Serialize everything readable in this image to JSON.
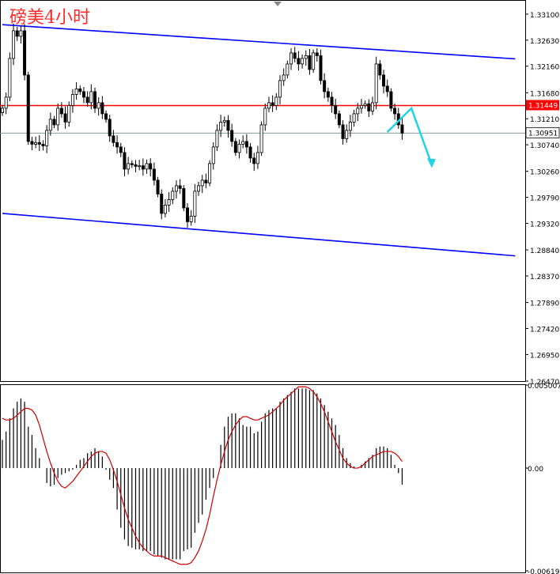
{
  "chart_data": [
    {
      "type": "candlestick",
      "title": "磅美4小时",
      "price_axis_ticks": [
        "1.33100",
        "1.32630",
        "1.32160",
        "1.31680",
        "1.31210",
        "1.30740",
        "1.30260",
        "1.29790",
        "1.29320",
        "1.28840",
        "1.28370",
        "1.27890",
        "1.27420",
        "1.26950",
        "1.26470"
      ],
      "ylim": [
        1.2647,
        1.3327
      ],
      "price_line_label": "1.31449",
      "price_line_value": 1.31449,
      "price_line_color": "#ff0000",
      "current_price_label": "1.30951",
      "current_price_value": 1.30951,
      "channel_color": "#0000ff",
      "channel_upper": [
        [
          0,
          1.3291
        ],
        [
          130,
          1.3233
        ]
      ],
      "channel_lower": [
        [
          0,
          1.295
        ],
        [
          130,
          1.2878
        ]
      ],
      "projection_color": "#22d3e6",
      "projection_path": [
        [
          104,
          1.3097
        ],
        [
          110.5,
          1.314
        ],
        [
          116,
          1.3038
        ]
      ],
      "closes": [
        1.314,
        1.316,
        1.323,
        1.328,
        1.327,
        1.328,
        1.32,
        1.308,
        1.3075,
        1.3078,
        1.3075,
        1.3072,
        1.31,
        1.312,
        1.311,
        1.314,
        1.313,
        1.3115,
        1.3145,
        1.3165,
        1.3175,
        1.317,
        1.316,
        1.315,
        1.317,
        1.314,
        1.315,
        1.313,
        1.312,
        1.309,
        1.3078,
        1.307,
        1.306,
        1.303,
        1.304,
        1.3038,
        1.3035,
        1.3036,
        1.303,
        1.304,
        1.303,
        1.301,
        1.2985,
        1.295,
        1.2965,
        1.2975,
        1.299,
        1.3,
        1.2995,
        1.296,
        1.2935,
        1.2945,
        1.299,
        1.3,
        1.301,
        1.3005,
        1.304,
        1.307,
        1.31,
        1.3115,
        1.3118,
        1.31,
        1.308,
        1.306,
        1.3075,
        1.308,
        1.307,
        1.305,
        1.304,
        1.306,
        1.311,
        1.314,
        1.315,
        1.3145,
        1.316,
        1.319,
        1.32,
        1.322,
        1.324,
        1.323,
        1.322,
        1.323,
        1.3235,
        1.321,
        1.324,
        1.3235,
        1.319,
        1.317,
        1.316,
        1.3145,
        1.313,
        1.311,
        1.3085,
        1.31,
        1.3115,
        1.313,
        1.314,
        1.3145,
        1.3148,
        1.3135,
        1.315,
        1.322,
        1.32,
        1.318,
        1.317,
        1.314,
        1.313,
        1.311,
        1.3095
      ],
      "oscillator": {
        "type": "histogram+signal",
        "ticks": [
          "0.005007",
          "0.00",
          "-0.006194"
        ],
        "ylim": [
          -0.006194,
          0.005007
        ],
        "bar_color": "#000000",
        "signal_color": "#cc0000",
        "histogram": [
          0.0017,
          0.0022,
          0.003,
          0.0036,
          0.004,
          0.0042,
          0.004,
          0.0025,
          0.002,
          0.0012,
          0.0006,
          0.0,
          -0.0009,
          -0.0011,
          -0.001,
          -0.0006,
          -0.0004,
          -0.0003,
          -0.0002,
          -0.0001,
          0.0002,
          0.0005,
          0.0006,
          0.0009,
          0.001,
          0.0012,
          0.001,
          0.0007,
          -0.0001,
          -0.0007,
          -0.0012,
          -0.0025,
          -0.0036,
          -0.0043,
          -0.0047,
          -0.0048,
          -0.0049,
          -0.0049,
          -0.005,
          -0.005,
          -0.005,
          -0.0052,
          -0.0053,
          -0.0054,
          -0.0055,
          -0.0055,
          -0.0055,
          -0.0055,
          -0.0055,
          -0.005,
          -0.0049,
          -0.0048,
          -0.0039,
          -0.0033,
          -0.0028,
          -0.0019,
          -0.0012,
          -0.0006,
          0.0,
          0.0014,
          0.0025,
          0.0031,
          0.0033,
          0.0033,
          0.003,
          0.0026,
          0.0025,
          0.0025,
          0.0021,
          0.0022,
          0.0028,
          0.0033,
          0.0035,
          0.0036,
          0.0036,
          0.004,
          0.0042,
          0.0044,
          0.0046,
          0.0048,
          0.0048,
          0.0048,
          0.0048,
          0.0047,
          0.0047,
          0.0045,
          0.0042,
          0.0038,
          0.0034,
          0.003,
          0.0026,
          0.002,
          0.0012,
          0.0006,
          0.0003,
          0.0001,
          0.0,
          0.0002,
          0.0004,
          0.0006,
          0.0008,
          0.0012,
          0.0013,
          0.0013,
          0.0012,
          0.0008,
          0.0002,
          -0.0003,
          -0.001
        ],
        "signal": [
          0.003,
          0.0029,
          0.0029,
          0.003,
          0.0032,
          0.0034,
          0.0036,
          0.0036,
          0.0035,
          0.0032,
          0.0026,
          0.0018,
          0.001,
          0.0003,
          -0.0003,
          -0.0008,
          -0.0011,
          -0.0012,
          -0.001,
          -0.0008,
          -0.0005,
          -0.0002,
          0.0001,
          0.0004,
          0.0007,
          0.0009,
          0.001,
          0.001,
          0.0009,
          0.0005,
          -0.0001,
          -0.0008,
          -0.0016,
          -0.0024,
          -0.0031,
          -0.0036,
          -0.0041,
          -0.0045,
          -0.0048,
          -0.005,
          -0.0052,
          -0.0053,
          -0.0053,
          -0.0053,
          -0.0054,
          -0.0055,
          -0.0056,
          -0.0057,
          -0.0058,
          -0.0058,
          -0.0058,
          -0.0057,
          -0.0054,
          -0.005,
          -0.0044,
          -0.0037,
          -0.0028,
          -0.0017,
          -0.0007,
          0.0002,
          0.001,
          0.0017,
          0.0022,
          0.0026,
          0.0029,
          0.0031,
          0.0031,
          0.003,
          0.0029,
          0.0029,
          0.003,
          0.0031,
          0.0032,
          0.0034,
          0.0036,
          0.0038,
          0.0041,
          0.0043,
          0.0045,
          0.0047,
          0.0049,
          0.0049,
          0.0049,
          0.0048,
          0.0046,
          0.0043,
          0.0039,
          0.0034,
          0.0028,
          0.0022,
          0.0016,
          0.0011,
          0.0006,
          0.0003,
          0.0001,
          0.0,
          0.0,
          0.0001,
          0.0003,
          0.0005,
          0.0007,
          0.0008,
          0.0009,
          0.001,
          0.001,
          0.001,
          0.0009,
          0.0007,
          0.0004
        ]
      }
    }
  ]
}
